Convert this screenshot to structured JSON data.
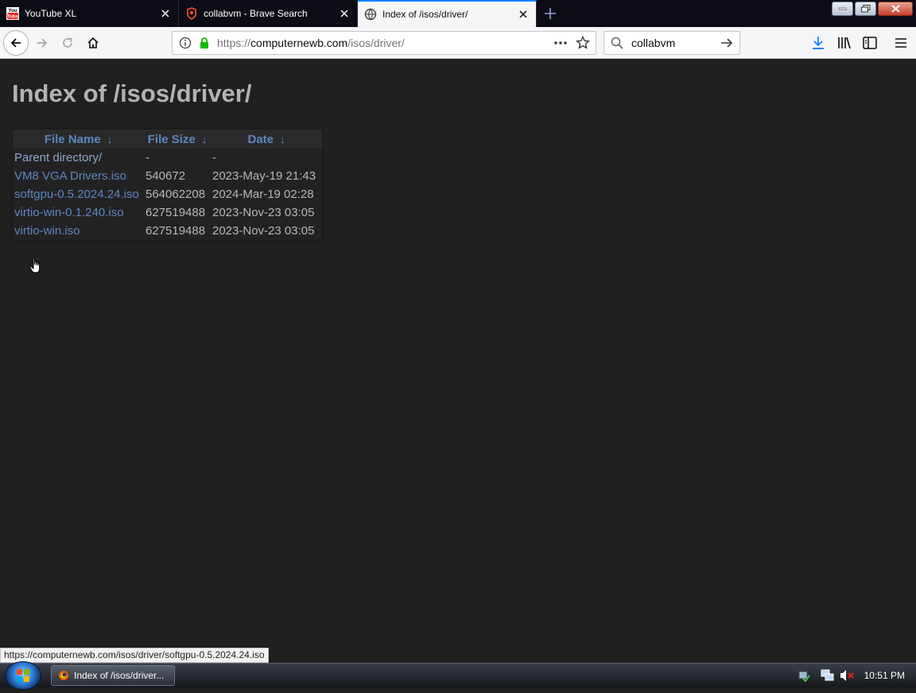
{
  "browser": {
    "tabs": [
      {
        "title": "YouTube XL",
        "icon": "youtube-icon",
        "active": false
      },
      {
        "title": "collabvm - Brave Search",
        "icon": "brave-icon",
        "active": false
      },
      {
        "title": "Index of /isos/driver/",
        "icon": "globe-icon",
        "active": true
      }
    ],
    "url": {
      "prefix": "https://",
      "host": "computernewb.com",
      "path": "/isos/driver/"
    },
    "search_value": "collabvm",
    "accent": "#0a84ff"
  },
  "page": {
    "title": "Index of /isos/driver/",
    "columns": {
      "name": "File Name",
      "size": "File Size",
      "date": "Date",
      "sort_arrow": "↓"
    },
    "rows": [
      {
        "name": "Parent directory/",
        "size": "-",
        "date": "-"
      },
      {
        "name": "VM8 VGA Drivers.iso",
        "size": "540672",
        "date": "2023-May-19 21:43"
      },
      {
        "name": "softgpu-0.5.2024.24.iso",
        "size": "564062208",
        "date": "2024-Mar-19 02:28"
      },
      {
        "name": "virtio-win-0.1.240.iso",
        "size": "627519488",
        "date": "2023-Nov-23 03:05"
      },
      {
        "name": "virtio-win.iso",
        "size": "627519488",
        "date": "2023-Nov-23 03:05"
      }
    ],
    "link_color": "#5d86c3"
  },
  "status_url": "https://computernewb.com/isos/driver/softgpu-0.5.2024.24.iso",
  "taskbar": {
    "window_title": "Index of /isos/driver...",
    "clock": "10:51 PM"
  }
}
